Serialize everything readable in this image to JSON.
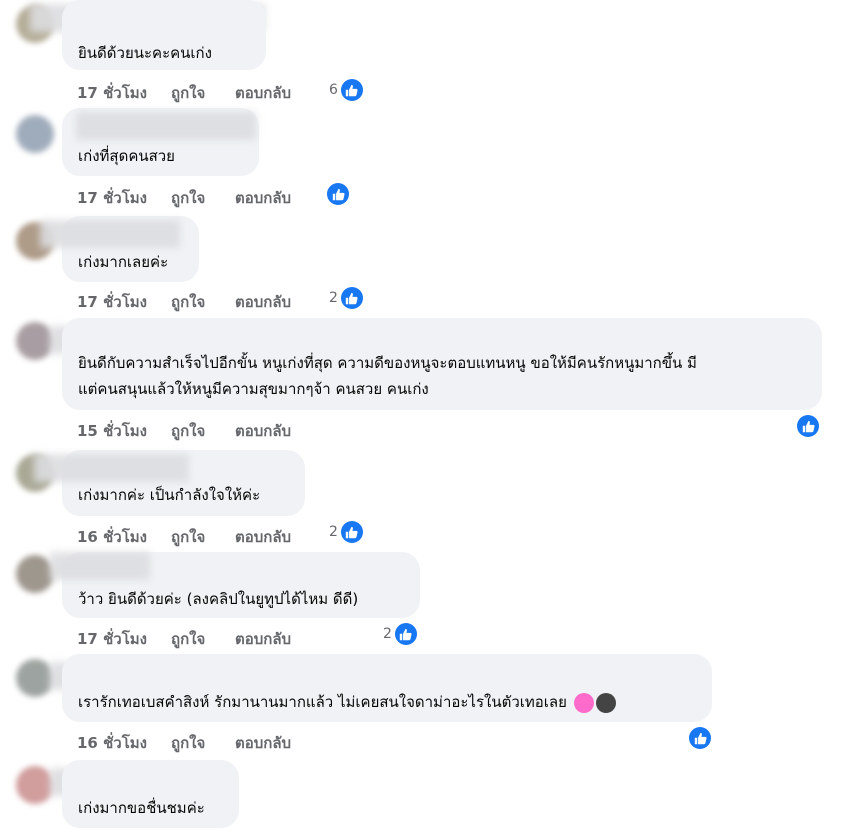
{
  "labels": {
    "like": "ถูกใจ",
    "reply": "ตอบกลับ"
  },
  "colors": {
    "like_blue": "#1877f2",
    "bubble_bg": "#f0f2f5",
    "meta_gray": "#65676b",
    "pink_heart": "#ff6bcb",
    "black_heart": "#444444"
  },
  "comments": [
    {
      "text": "ยินดีด้วยนะคะคนเก่ง",
      "time": "17 ชั่วโมง",
      "reactions": "6"
    },
    {
      "text": "เก่งที่สุดคนสวย",
      "time": "17 ชั่วโมง",
      "reactions": ""
    },
    {
      "text": "เก่งมากเลยค่ะ",
      "time": "17 ชั่วโมง",
      "reactions": "2"
    },
    {
      "text_line1": "ยินดีกับความสำเร็จไปอีกขั้น หนูเก่งที่สุด ความดีของหนูจะตอบแทนหนู ขอให้มีคนรักหนูมากขึ้น มี",
      "text_line2": "แต่คนสนุนแล้วให้หนูมีความสุขมากๆจ้า คนสวย คนเก่ง",
      "time": "15 ชั่วโมง",
      "reactions": ""
    },
    {
      "text": "เก่งมากค่ะ เป็นกำลังใจให้ค่ะ",
      "time": "16 ชั่วโมง",
      "reactions": "2"
    },
    {
      "text": "ว้าว ยินดีด้วยค่ะ (ลงคลิปในยูทูปได้ไหม ดีดี)",
      "time": "17 ชั่วโมง",
      "reactions": "2"
    },
    {
      "text": "เรารักเทอเบสคำสิงห์ รักมานานมากแล้ว ไม่เคยสนใจดาม่าอะไรในตัวเทอเลย",
      "time": "16 ชั่วโมง",
      "reactions": ""
    },
    {
      "text": "เก่งมากขอชื่นชมค่ะ",
      "time": "",
      "reactions": ""
    }
  ]
}
